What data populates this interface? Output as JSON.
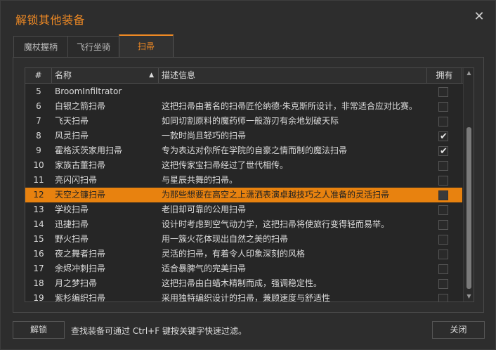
{
  "window": {
    "title": "解锁其他装备",
    "accent": "#f08a24"
  },
  "tabs": [
    {
      "label": "魔杖握柄",
      "active": false
    },
    {
      "label": "飞行坐骑",
      "active": false
    },
    {
      "label": "扫帚",
      "active": true
    }
  ],
  "table": {
    "columns": {
      "num": "#",
      "name": "名称",
      "desc": "描述信息",
      "owned": "拥有"
    },
    "sort": {
      "column": "name",
      "direction": "ascending"
    },
    "rows": [
      {
        "num": "5",
        "name": "BroomInfiltrator",
        "desc": "",
        "owned": false
      },
      {
        "num": "6",
        "name": "白银之箭扫帚",
        "desc": "这把扫帚由著名的扫帚匠伦纳德·朱克斯所设计，非常适合应对比赛。",
        "owned": false
      },
      {
        "num": "7",
        "name": "飞天扫帚",
        "desc": "如同切割原料的魔药师一般游刃有余地划破天际",
        "owned": false
      },
      {
        "num": "8",
        "name": "风灵扫帚",
        "desc": "一款时尚且轻巧的扫帚",
        "owned": true
      },
      {
        "num": "9",
        "name": "霍格沃茨家用扫帚",
        "desc": "专为表达对你所在学院的自豪之情而制的魔法扫帚",
        "owned": true
      },
      {
        "num": "10",
        "name": "家族古董扫帚",
        "desc": "这把传家宝扫帚经过了世代相传。",
        "owned": false
      },
      {
        "num": "11",
        "name": "亮闪闪扫帚",
        "desc": "与星辰共舞的扫帚。",
        "owned": false
      },
      {
        "num": "12",
        "name": "天空之镰扫帚",
        "desc": "为那些想要在高空之上潇洒表演卓越技巧之人准备的灵活扫帚",
        "owned": false,
        "selected": true
      },
      {
        "num": "13",
        "name": "学校扫帚",
        "desc": "老旧却可靠的公用扫帚",
        "owned": false
      },
      {
        "num": "14",
        "name": "迅捷扫帚",
        "desc": "设计时考虑到空气动力学，这把扫帚将使旅行变得轻而易举。",
        "owned": false
      },
      {
        "num": "15",
        "name": "野火扫帚",
        "desc": "用一簇火花体现出自然之美的扫帚",
        "owned": false
      },
      {
        "num": "16",
        "name": "夜之舞者扫帚",
        "desc": "灵活的扫帚，有着令人印象深刻的风格",
        "owned": false
      },
      {
        "num": "17",
        "name": "余烬冲刺扫帚",
        "desc": "适合暴脾气的完美扫帚",
        "owned": false
      },
      {
        "num": "18",
        "name": "月之梦扫帚",
        "desc": "这把扫帚由白蜡木精制而成，强调稳定性。",
        "owned": false
      },
      {
        "num": "19",
        "name": "紫杉编织扫帚",
        "desc": "采用独特编织设计的扫帚，兼顾速度与舒适性",
        "owned": false
      }
    ]
  },
  "footer": {
    "unlock_label": "解锁",
    "hint": "查找装备可通过 Ctrl+F 键按关键字快速过滤。",
    "close_label": "关闭"
  },
  "icons": {
    "close": "close-icon",
    "sort": "sort-ascending-icon",
    "check": "checkmark-icon",
    "scroll_up": "scroll-up-icon",
    "scroll_down": "scroll-down-icon"
  }
}
